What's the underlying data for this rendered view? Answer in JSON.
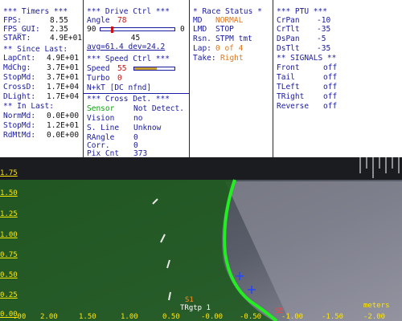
{
  "timers": {
    "header": "*** Timers ***",
    "fps_label": "FPS:",
    "fps_value": "8.55",
    "fps_gui_label": "FPS_GUI:",
    "fps_gui_value": "2.35",
    "start_label": "START:",
    "start_value": "4.9E+01",
    "since_header": "** Since Last:",
    "lapcnt_label": "LapCnt:",
    "lapcnt_value": "4.9E+01",
    "mdchg_label": "MdChg:",
    "mdchg_value": "3.7E+01",
    "stopmd_label": "StopMd:",
    "stopmd_value": "3.7E+01",
    "crossd_label": "CrossD:",
    "crossd_value": "1.7E+04",
    "dlight_label": "DLight:",
    "dlight_value": "1.7E+04",
    "in_header": "** In Last:",
    "normmd_label": "NormMd:",
    "normmd_value": "0.0E+00",
    "stopmd2_label": "StopMd:",
    "stopmd2_value": "1.2E+01",
    "rdmtmd_label": "RdMtMd:",
    "rdmtmd_value": "0.0E+00"
  },
  "drive": {
    "header": "***  Drive Ctrl  ***",
    "angle_label": "Angle",
    "angle_value": "78",
    "range_min": "90",
    "range_max": "0",
    "center": "45",
    "angle_fraction": 0.14,
    "avg_label": "avg=61.4  dev=24.2",
    "speed_header": "***  Speed Ctrl  ***",
    "speed_label": "Speed",
    "speed_value": "55",
    "speed_fraction": 0.55,
    "turbo_label": "Turbo",
    "turbo_value": "0",
    "nkt_label": "N+kT [DC nfnd]"
  },
  "cross": {
    "header": "*** Cross Det. ***",
    "sensor_label": "Sensor",
    "sensor_value": "Not Detect.",
    "vision_label": "Vision",
    "vision_value": "no",
    "sline_label": "S. Line",
    "sline_value": "Unknow",
    "rangle_label": "RAngle",
    "rangle_value": "0",
    "corr_label": "Corr.",
    "corr_value": "0",
    "pixcnt_label": "Pix Cnt",
    "pixcnt_value": "373"
  },
  "race": {
    "header": "* Race Status *",
    "md_label": "MD",
    "md_value": "NORMAL",
    "lmd_label": "LMD",
    "lmd_value": "STOP",
    "rsn_label": "Rsn.",
    "rsn_value": "STPM tmt",
    "lap_label": "Lap:",
    "lap_value": "0 of 4",
    "take_label": "Take:",
    "take_value": "Right"
  },
  "ptu": {
    "header": "*** PTU ***",
    "crpan_label": "CrPan",
    "crpan_value": "-10",
    "crtlt_label": "CrTlt",
    "crtlt_value": "-35",
    "dspan_label": "DsPan",
    "dspan_value": "-5",
    "dstlt_label": "DsTlt",
    "dstlt_value": "-35"
  },
  "signals": {
    "header": "** SIGNALS **",
    "items": [
      {
        "label": "Front",
        "value": "off"
      },
      {
        "label": "Tail",
        "value": "off"
      },
      {
        "label": "TLeft",
        "value": "off"
      },
      {
        "label": "TRight",
        "value": "off"
      },
      {
        "label": "Reverse",
        "value": "off"
      }
    ]
  },
  "camera": {
    "y_ticks": [
      "1.75",
      "1.50",
      "1.25",
      "1.00",
      "0.75",
      "0.50",
      "0.25",
      "0.00"
    ],
    "x_ticks": [
      "2.00",
      "1.50",
      "1.00",
      "0.50",
      "-0.00",
      "-0.50",
      "-1.00",
      "-1.50",
      "-2.00"
    ],
    "x_ticks_partial": [
      ".00"
    ],
    "units": "meters",
    "overlay_label_1": "S1",
    "overlay_label_2": "TRgtp 1",
    "overlay_label_3": "S5"
  },
  "colors": {
    "panel_bg": "#ffffff",
    "header_blue": "#1a1aa0",
    "value_red": "#d01010",
    "value_orange": "#e07820",
    "sensor_green": "#10a010",
    "track_line": "#22ee22",
    "axis_yellow": "#ffe600"
  }
}
